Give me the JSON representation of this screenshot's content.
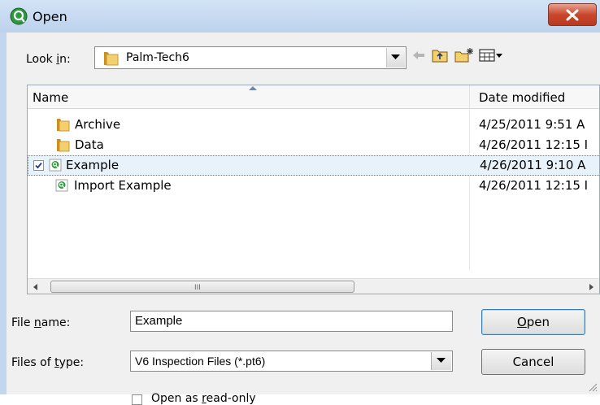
{
  "window": {
    "title": "Open",
    "close_symbol": "X"
  },
  "toolbar": {
    "look_in_label_pre": "Look ",
    "look_in_label_key": "i",
    "look_in_label_post": "n:",
    "look_in_value": "Palm-Tech6",
    "back_icon": "back-arrow-icon",
    "up_folder_icon": "up-folder-icon",
    "new_folder_icon": "new-folder-icon",
    "views_icon": "view-menu-icon"
  },
  "file_list": {
    "columns": [
      "Name",
      "Date modified"
    ],
    "rows": [
      {
        "name": "Archive",
        "date": "4/25/2011 9:51 A",
        "type": "folder",
        "selected": false
      },
      {
        "name": "Data",
        "date": "4/26/2011 12:15 I",
        "type": "folder",
        "selected": false
      },
      {
        "name": "Example",
        "date": "4/26/2011 9:10 A",
        "type": "pt6",
        "selected": true
      },
      {
        "name": "Import Example",
        "date": "4/26/2011 12:15 I",
        "type": "pt6",
        "selected": false
      }
    ],
    "scroll_grip": "III"
  },
  "filename": {
    "label_pre": "File ",
    "label_key": "n",
    "label_post": "ame:",
    "value": "Example"
  },
  "filetype": {
    "label_pre": "Files of ",
    "label_key": "t",
    "label_post": "ype:",
    "value": "V6 Inspection Files (*.pt6)"
  },
  "buttons": {
    "open_key": "O",
    "open_rest": "pen",
    "cancel": "Cancel"
  },
  "readonly": {
    "label_pre": "Open as ",
    "label_key": "r",
    "label_post": "ead-only",
    "checked": false
  },
  "colors": {
    "title_bar": "#c2d6ee",
    "close_button": "#c9472d",
    "selection": "#e8f2fb",
    "folder": "#e8b54a"
  }
}
